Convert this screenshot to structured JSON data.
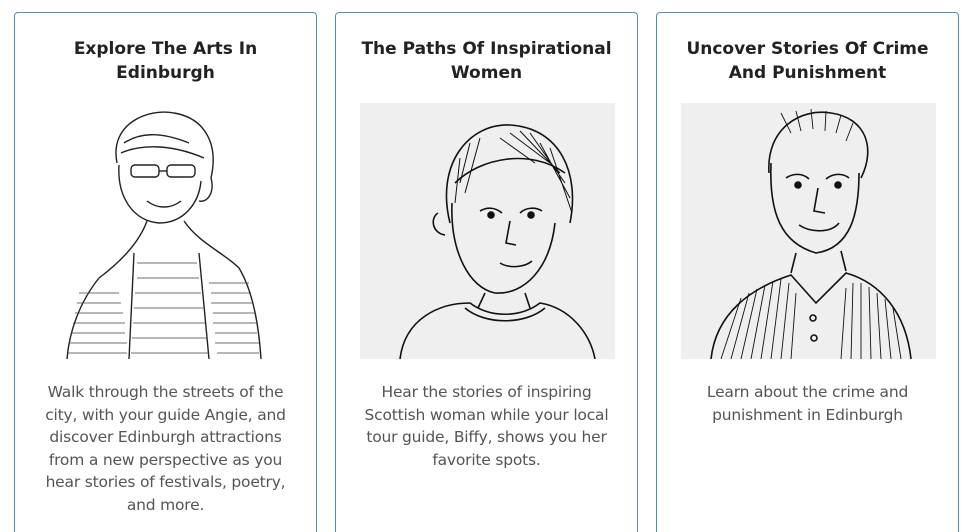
{
  "cards": [
    {
      "title": "Explore The Arts In Edinburgh",
      "image_subject": "sketch-portrait-angie",
      "description": "Walk through the streets of the city, with your guide Angie, and discover Edinburgh attractions from a new perspective as you hear stories of festivals, poetry, and more."
    },
    {
      "title": "The Paths Of Inspirational Women",
      "image_subject": "sketch-portrait-biffy",
      "description": "Hear the stories of inspiring Scottish woman while your local tour guide, Biffy, shows you her favorite spots."
    },
    {
      "title": "Uncover Stories Of Crime And Punishment",
      "image_subject": "sketch-portrait-guide",
      "description": "Learn about the crime and punishment in Edinburgh"
    }
  ],
  "colors": {
    "card_border": "#4a90c8",
    "title_text": "#222222",
    "body_text": "#555555"
  }
}
